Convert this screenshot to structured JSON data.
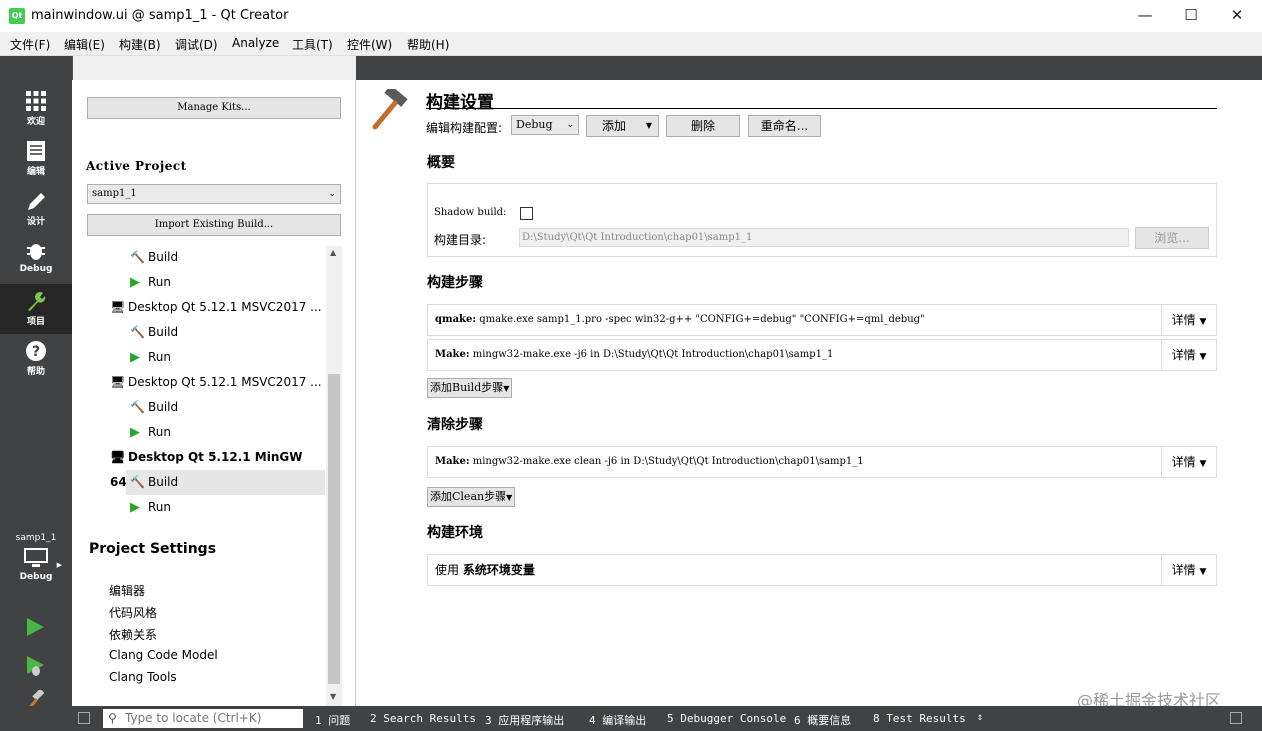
{
  "window": {
    "title": "mainwindow.ui @ samp1_1 - Qt Creator",
    "app_icon": "qt-icon",
    "controls": [
      "minimize",
      "maximize",
      "close"
    ]
  },
  "menu": [
    "文件(F)",
    "编辑(E)",
    "构建(B)",
    "调试(D)",
    "Analyze",
    "工具(T)",
    "控件(W)",
    "帮助(H)"
  ],
  "modes": [
    {
      "label": "欢迎",
      "icon": "grid-icon"
    },
    {
      "label": "编辑",
      "icon": "document-icon"
    },
    {
      "label": "设计",
      "icon": "pencil-icon"
    },
    {
      "label": "Debug",
      "icon": "bug-icon"
    },
    {
      "label": "项目",
      "icon": "wrench-icon"
    },
    {
      "label": "帮助",
      "icon": "help-icon"
    }
  ],
  "kit_selector": {
    "project": "samp1_1",
    "mode": "Debug"
  },
  "sidebar": {
    "manage_kits": "Manage Kits...",
    "active_project_heading": "Active Project",
    "active_project": "samp1_1",
    "import_build": "Import Existing Build...",
    "tree": [
      {
        "type": "build",
        "label": "Build"
      },
      {
        "type": "run",
        "label": "Run"
      },
      {
        "type": "kit",
        "label": "Desktop Qt 5.12.1 MSVC2017 ..."
      },
      {
        "type": "build",
        "label": "Build"
      },
      {
        "type": "run",
        "label": "Run"
      },
      {
        "type": "kit",
        "label": "Desktop Qt 5.12.1 MSVC2017 ..."
      },
      {
        "type": "build",
        "label": "Build"
      },
      {
        "type": "run",
        "label": "Run"
      },
      {
        "type": "kit-bold",
        "label": "Desktop Qt 5.12.1 MinGW 64..."
      },
      {
        "type": "build-selected",
        "label": "Build"
      },
      {
        "type": "run",
        "label": "Run"
      }
    ],
    "project_settings_heading": "Project Settings",
    "project_settings": [
      "编辑器",
      "代码风格",
      "依赖关系",
      "Clang Code Model",
      "Clang Tools"
    ]
  },
  "main": {
    "title": "构建设置",
    "edit_config_label": "编辑构建配置:",
    "config_value": "Debug",
    "add_label": "添加",
    "delete_label": "删除",
    "rename_label": "重命名...",
    "overview_heading": "概要",
    "shadow_build_label": "Shadow build:",
    "build_dir_label": "构建目录:",
    "build_dir_value": "D:\\Study\\Qt\\Qt Introduction\\chap01\\samp1_1",
    "browse_label": "浏览...",
    "build_steps_heading": "构建步骤",
    "build_steps": [
      {
        "tool": "qmake:",
        "args": "qmake.exe samp1_1.pro -spec win32-g++ \"CONFIG+=debug\" \"CONFIG+=qml_debug\""
      },
      {
        "tool": "Make:",
        "args": "mingw32-make.exe -j6 in D:\\Study\\Qt\\Qt Introduction\\chap01\\samp1_1"
      }
    ],
    "add_build_step": "添加Build步骤",
    "clean_steps_heading": "清除步骤",
    "clean_steps": [
      {
        "tool": "Make:",
        "args": "mingw32-make.exe clean -j6 in D:\\Study\\Qt\\Qt Introduction\\chap01\\samp1_1"
      }
    ],
    "add_clean_step": "添加Clean步骤",
    "env_heading": "构建环境",
    "env_use": "使用",
    "env_value": "系统环境变量",
    "details_label": "详情"
  },
  "statusbar": {
    "locate_placeholder": "Type to locate (Ctrl+K)",
    "panes": [
      "1 问题",
      "2 Search Results",
      "3 应用程序输出",
      "4 编译输出",
      "5 Debugger Console",
      "6 概要信息",
      "8 Test Results"
    ],
    "watermark": "@稀土掘金技术社区"
  }
}
